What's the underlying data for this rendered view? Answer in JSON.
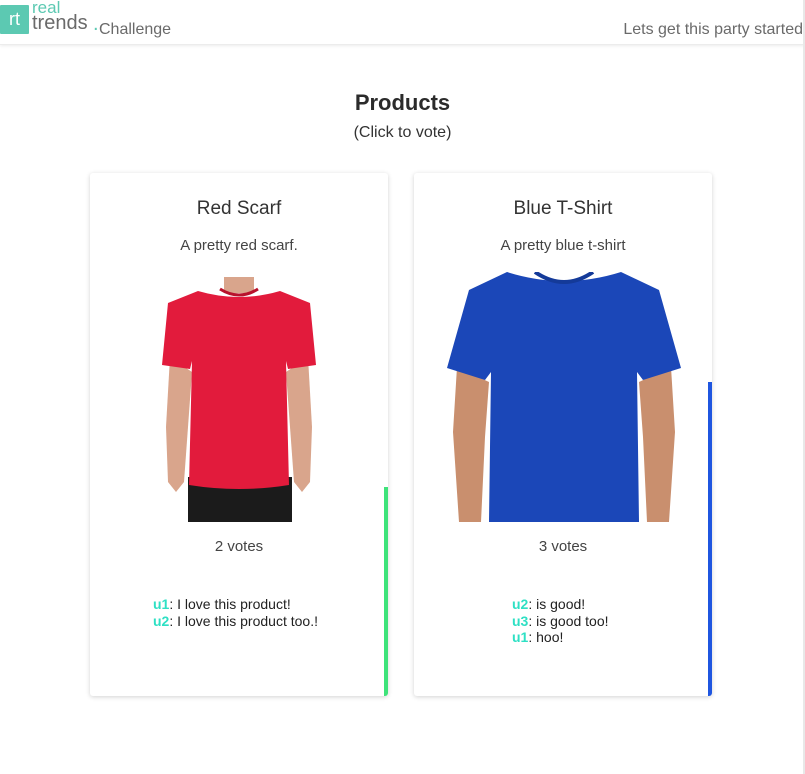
{
  "header": {
    "logo_mark": "rt",
    "logo_top": "real",
    "logo_bottom": "trends",
    "logo_dot": ".",
    "logo_suffix": "Challenge",
    "tagline": "Lets get this party started"
  },
  "page": {
    "title": "Products",
    "subtitle": "(Click to vote)"
  },
  "products": [
    {
      "name": "Red Scarf",
      "description": "A pretty red scarf.",
      "votes_label": "2 votes",
      "vote_share": 0.4,
      "bar_color": "#3ee37a",
      "shirt_color": "#e21b3c",
      "comments": [
        {
          "user": "u1",
          "text": ": I love this product!"
        },
        {
          "user": "u2",
          "text": ": I love this product too.!"
        }
      ]
    },
    {
      "name": "Blue T-Shirt",
      "description": "A pretty blue t-shirt",
      "votes_label": "3 votes",
      "vote_share": 0.6,
      "bar_color": "#1f56e0",
      "shirt_color": "#1b47b8",
      "comments": [
        {
          "user": "u2",
          "text": ": is good!"
        },
        {
          "user": "u3",
          "text": ": is good too!"
        },
        {
          "user": "u1",
          "text": ": hoo!"
        }
      ]
    }
  ]
}
